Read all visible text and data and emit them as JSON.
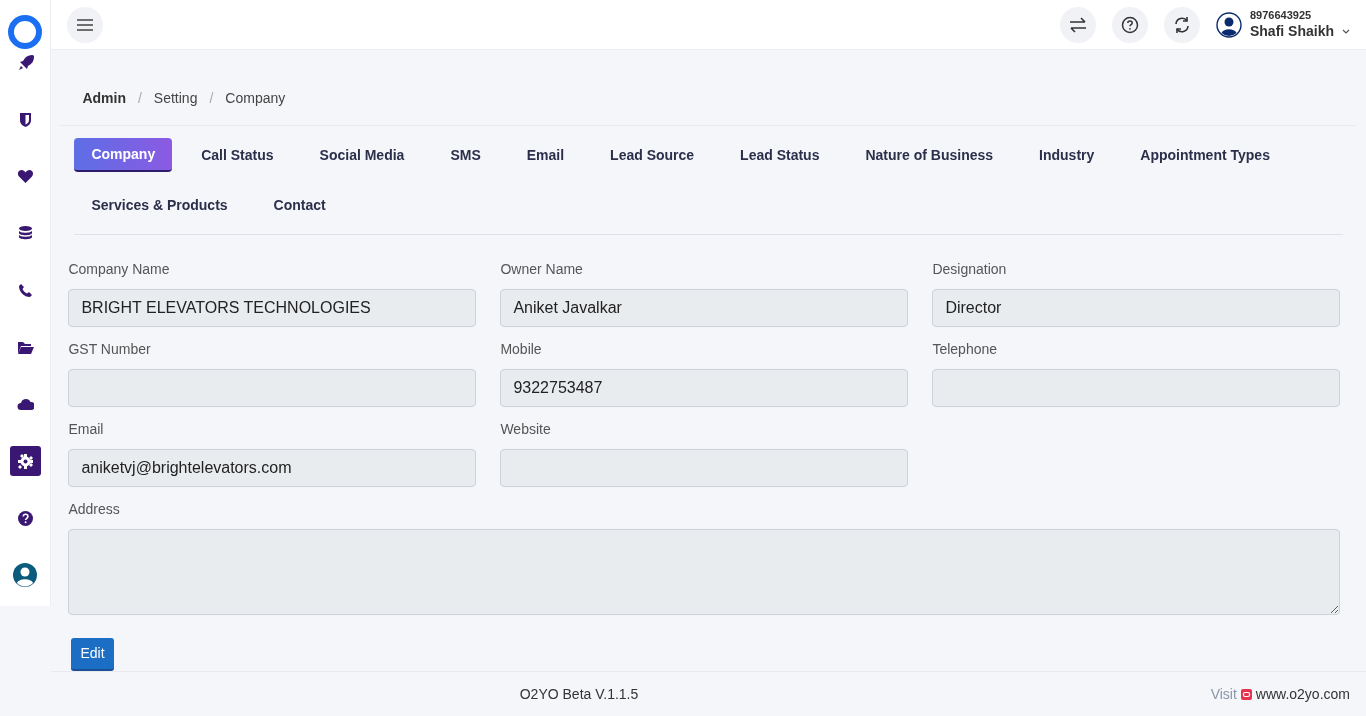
{
  "sidebar": {
    "items": [
      {
        "selected": false
      },
      {
        "selected": false
      },
      {
        "selected": false
      },
      {
        "selected": false
      },
      {
        "selected": false
      },
      {
        "selected": false
      },
      {
        "selected": false
      },
      {
        "selected": true
      },
      {
        "selected": false
      },
      {
        "selected": false
      }
    ]
  },
  "header": {
    "phone": "8976643925",
    "user_name": "Shafi Shaikh"
  },
  "breadcrumb": [
    {
      "label": "Admin"
    },
    {
      "label": "Setting"
    },
    {
      "label": "Company"
    }
  ],
  "breadcrumb_separator": "/",
  "tabs": [
    {
      "label": "Company",
      "selected": true
    },
    {
      "label": "Call Status",
      "selected": false
    },
    {
      "label": "Social Media",
      "selected": false
    },
    {
      "label": "SMS",
      "selected": false
    },
    {
      "label": "Email",
      "selected": false
    },
    {
      "label": "Lead Source",
      "selected": false
    },
    {
      "label": "Lead Status",
      "selected": false
    },
    {
      "label": "Nature of Business",
      "selected": false
    },
    {
      "label": "Industry",
      "selected": false
    },
    {
      "label": "Appointment Types",
      "selected": false
    },
    {
      "label": "Services & Products",
      "selected": false
    },
    {
      "label": "Contact",
      "selected": false
    }
  ],
  "form": {
    "fields": [
      {
        "label": "Company Name",
        "value": "BRIGHT ELEVATORS TECHNOLOGIES",
        "kind": "input"
      },
      {
        "label": "Owner Name",
        "value": "Aniket Javalkar",
        "kind": "input"
      },
      {
        "label": "Designation",
        "value": "Director",
        "kind": "input"
      },
      {
        "label": "GST Number",
        "kind": "input"
      },
      {
        "label": "Mobile",
        "value": "9322753487",
        "kind": "input"
      },
      {
        "label": "Telephone",
        "kind": "input"
      },
      {
        "label": "Email",
        "value": "aniketvj@brightelevators.com",
        "kind": "input"
      },
      {
        "label": "Website",
        "kind": "input"
      },
      {
        "label": "Address",
        "kind": "textarea"
      }
    ],
    "button": "Edit"
  },
  "footer": {
    "version": "O2YO Beta V.1.1.5",
    "visit_label": "Visit",
    "link": "www.o2yo.com"
  }
}
